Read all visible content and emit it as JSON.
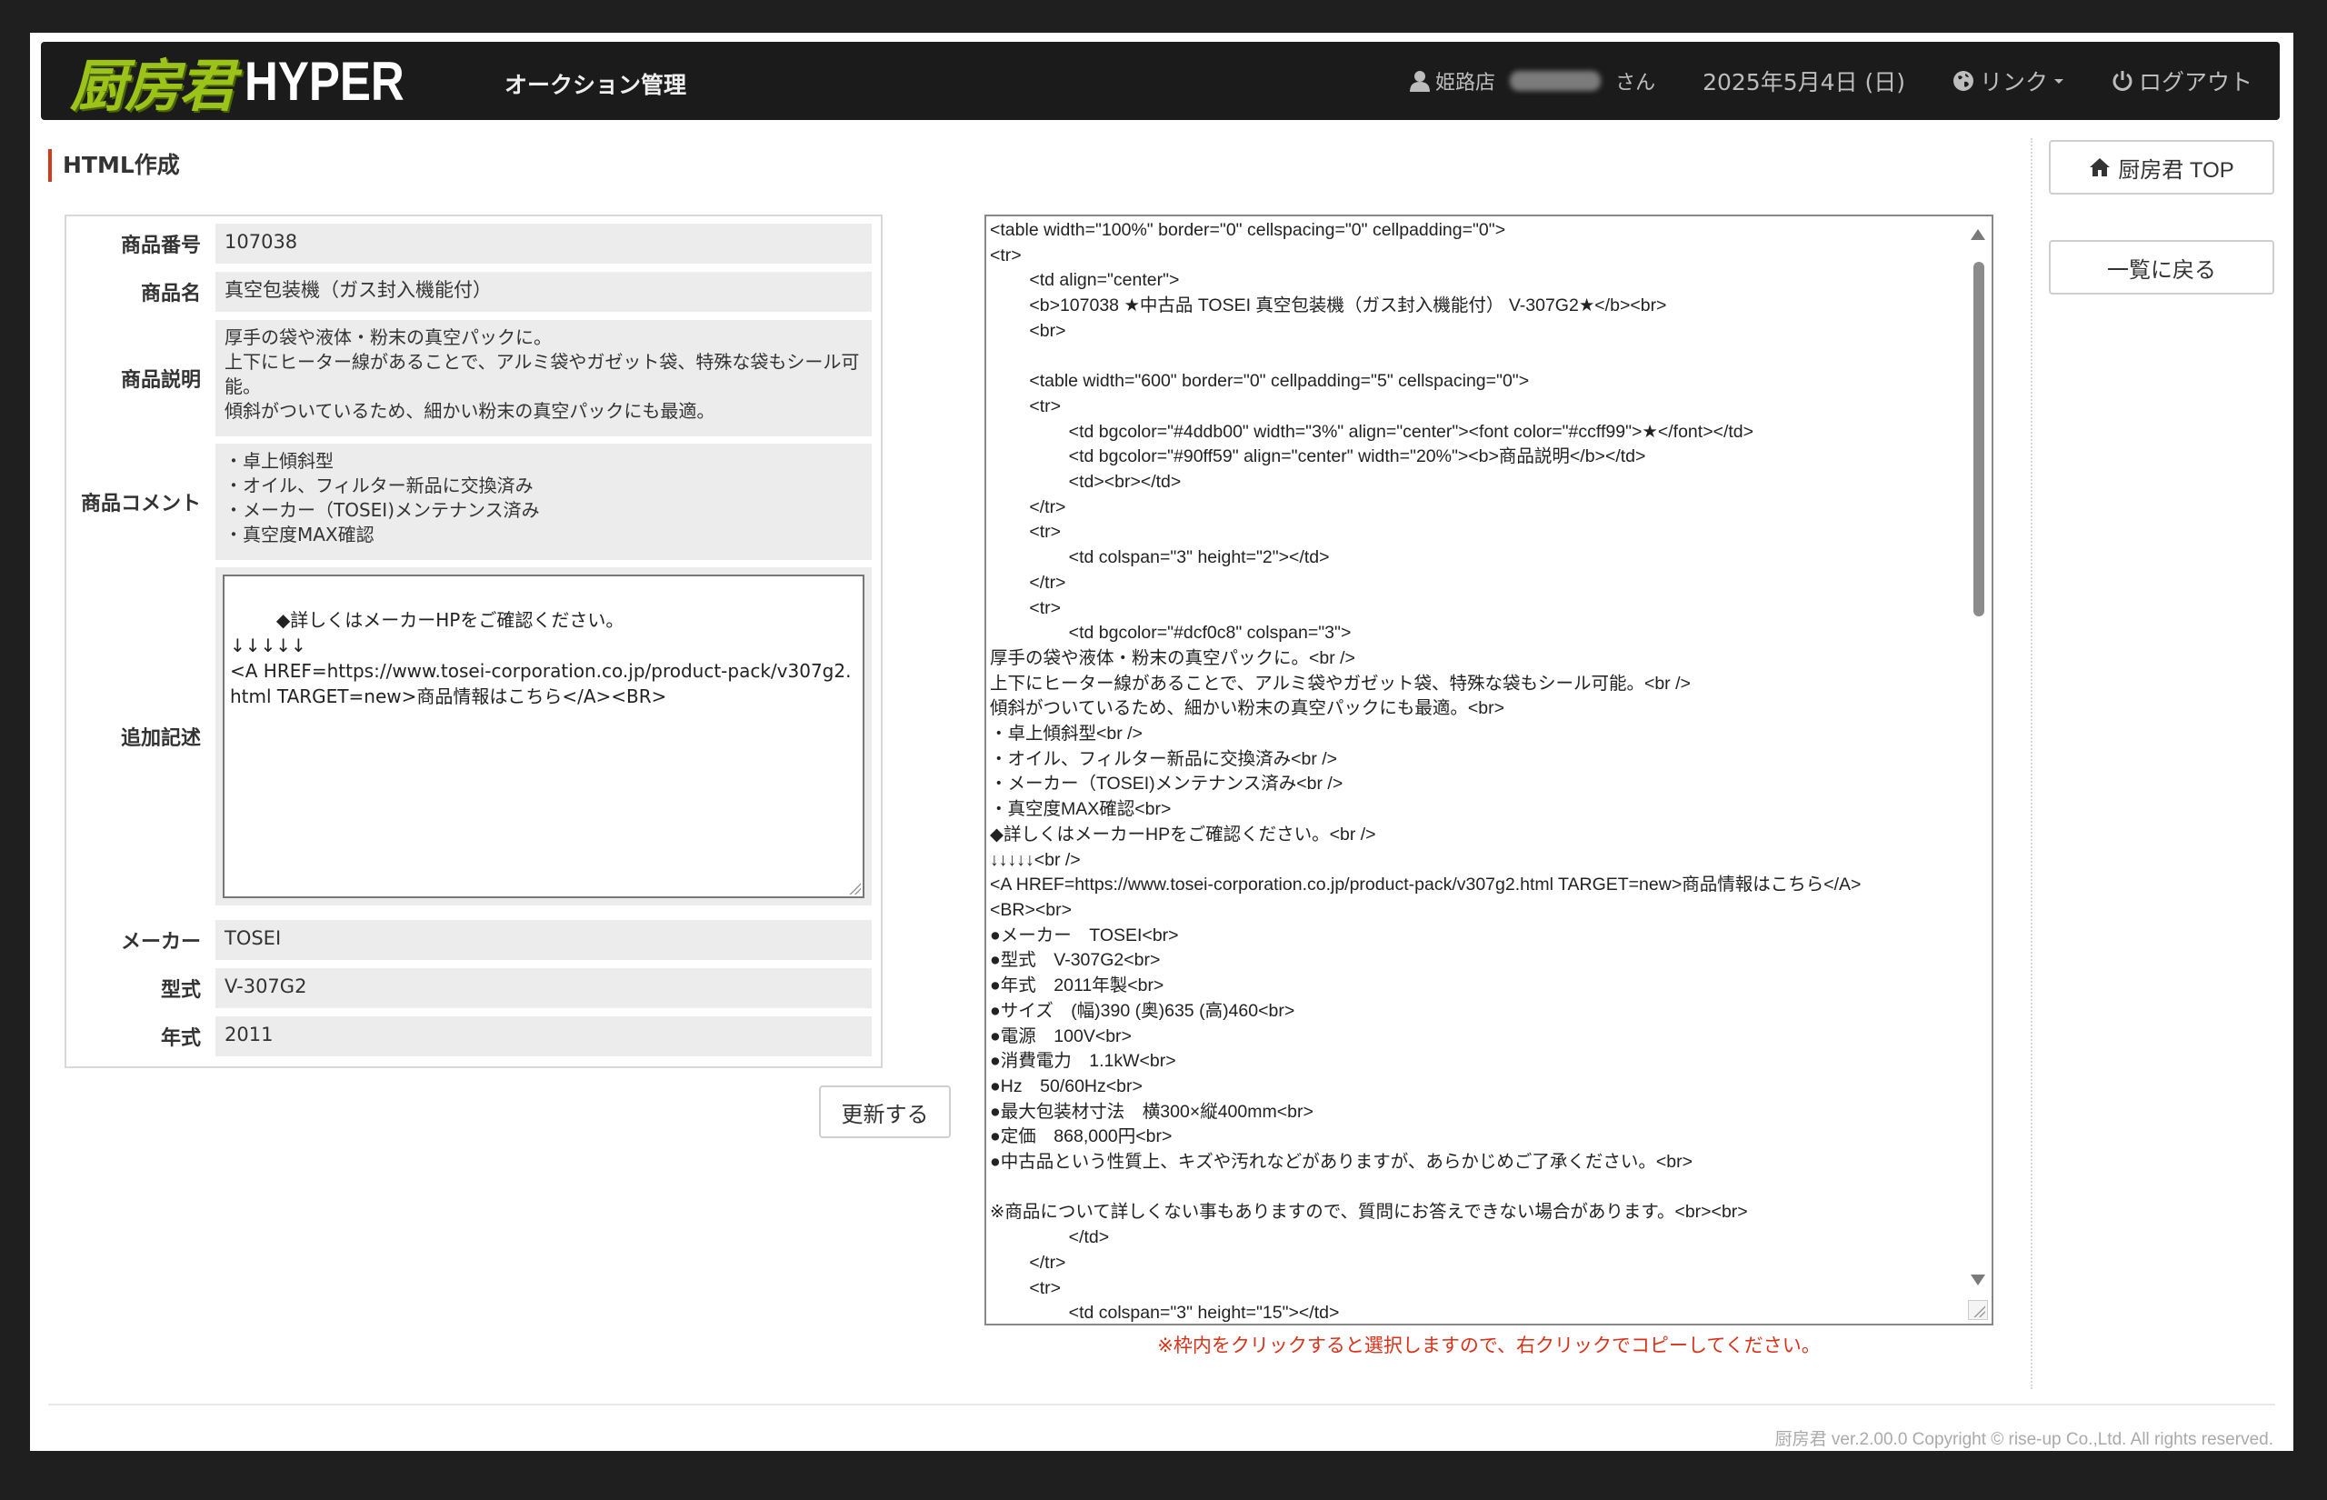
{
  "header": {
    "logo_jp": "厨房君",
    "logo_en": "HYPER",
    "nav_title": "オークション管理",
    "user_store": "姫路店",
    "user_suffix": "さん",
    "date": "2025年5月4日 (日)",
    "link_label": "リンク",
    "logout_label": "ログアウト"
  },
  "section_title": "HTML作成",
  "form": {
    "product_number": {
      "label": "商品番号",
      "value": "107038"
    },
    "product_name": {
      "label": "商品名",
      "value": "真空包装機（ガス封入機能付）"
    },
    "description": {
      "label": "商品説明",
      "value": "厚手の袋や液体・粉末の真空パックに。\n上下にヒーター線があることで、アルミ袋やガゼット袋、特殊な袋もシール可能。\n傾斜がついているため、細かい粉末の真空パックにも最適。"
    },
    "comment": {
      "label": "商品コメント",
      "value": "・卓上傾斜型\n・オイル、フィルター新品に交換済み\n・メーカー（TOSEI)メンテナンス済み\n・真空度MAX確認"
    },
    "additional": {
      "label": "追加記述",
      "value": "◆詳しくはメーカーHPをご確認ください。\n↓↓↓↓↓\n<A HREF=https://www.tosei-corporation.co.jp/product-pack/v307g2.html TARGET=new>商品情報はこちら</A><BR>"
    },
    "maker": {
      "label": "メーカー",
      "value": "TOSEI"
    },
    "model": {
      "label": "型式",
      "value": "V-307G2"
    },
    "year": {
      "label": "年式",
      "value": "2011"
    }
  },
  "buttons": {
    "update": "更新する",
    "top": "厨房君 TOP",
    "back": "一覧に戻る"
  },
  "html_output": "<table width=\"100%\" border=\"0\" cellspacing=\"0\" cellpadding=\"0\">\n<tr>\n        <td align=\"center\">\n        <b>107038 ★中古品 TOSEI 真空包装機（ガス封入機能付） V-307G2★</b><br>\n        <br>\n\n        <table width=\"600\" border=\"0\" cellpadding=\"5\" cellspacing=\"0\">\n        <tr>\n                <td bgcolor=\"#4ddb00\" width=\"3%\" align=\"center\"><font color=\"#ccff99\">★</font></td>\n                <td bgcolor=\"#90ff59\" align=\"center\" width=\"20%\"><b>商品説明</b></td>\n                <td><br></td>\n        </tr>\n        <tr>\n                <td colspan=\"3\" height=\"2\"></td>\n        </tr>\n        <tr>\n                <td bgcolor=\"#dcf0c8\" colspan=\"3\">\n厚手の袋や液体・粉末の真空パックに。<br />\n上下にヒーター線があることで、アルミ袋やガゼット袋、特殊な袋もシール可能。<br />\n傾斜がついているため、細かい粉末の真空パックにも最適。<br>\n・卓上傾斜型<br />\n・オイル、フィルター新品に交換済み<br />\n・メーカー（TOSEI)メンテナンス済み<br />\n・真空度MAX確認<br>\n◆詳しくはメーカーHPをご確認ください。<br />\n↓↓↓↓↓<br />\n<A HREF=https://www.tosei-corporation.co.jp/product-pack/v307g2.html TARGET=new>商品情報はこちら</A>\n<BR><br>\n●メーカー　TOSEI<br>\n●型式　V-307G2<br>\n●年式　2011年製<br>\n●サイズ　(幅)390 (奥)635 (高)460<br>\n●電源　100V<br>\n●消費電力　1.1kW<br>\n●Hz　50/60Hz<br>\n●最大包装材寸法　横300×縦400mm<br>\n●定価　868,000円<br>\n●中古品という性質上、キズや汚れなどがありますが、あらかじめご了承ください。<br>\n\n※商品について詳しくない事もありますので、質問にお答えできない場合があります。<br><br>\n                </td>\n        </tr>\n        <tr>\n                <td colspan=\"3\" height=\"15\"></td>",
  "note": "※枠内をクリックすると選択しますので、右クリックでコピーしてください。",
  "footer": "厨房君 ver.2.00.0 Copyright © rise-up Co.,Ltd. All rights reserved."
}
